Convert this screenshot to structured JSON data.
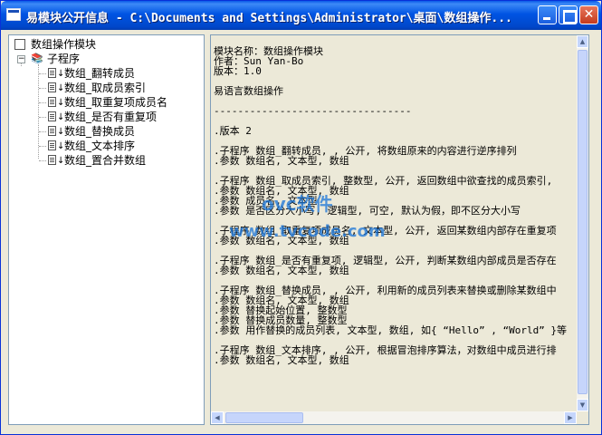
{
  "window": {
    "title": "易模块公开信息 - C:\\Documents and Settings\\Administrator\\桌面\\数组操作..."
  },
  "tree": {
    "root": {
      "label": "数组操作模块",
      "icon": "module-icon"
    },
    "group": {
      "label": "子程序",
      "icon": "books-icon",
      "expander": "−"
    },
    "items": [
      {
        "label": "数组_翻转成员",
        "icon": "subroutine-icon"
      },
      {
        "label": "数组_取成员索引",
        "icon": "subroutine-icon"
      },
      {
        "label": "数组_取重复项成员名",
        "icon": "subroutine-icon"
      },
      {
        "label": "数组_是否有重复项",
        "icon": "subroutine-icon"
      },
      {
        "label": "数组_替换成员",
        "icon": "subroutine-icon"
      },
      {
        "label": "数组_文本排序",
        "icon": "subroutine-icon"
      },
      {
        "label": "数组_置合并数组",
        "icon": "subroutine-icon"
      }
    ]
  },
  "content": {
    "text": "模块名称：数组操作模块\n作者：Sun Yan-Bo\n版本：1.0\n\n易语言数组操作\n\n---------------------------------\n\n.版本 2\n\n.子程序 数组_翻转成员, , 公开, 将数组原来的内容进行逆序排列\n.参数 数组名, 文本型, 数组\n\n.子程序 数组_取成员索引, 整数型, 公开, 返回数组中欲查找的成员索引,\n.参数 数组名, 文本型, 数组\n.参数 成员名, 文本型\n.参数 是否区分大小写, 逻辑型, 可空, 默认为假，即不区分大小写\n\n.子程序 数组_取重复项成员名, 文本型, 公开, 返回某数组内部存在重复项\n.参数 数组名, 文本型, 数组\n\n.子程序 数组_是否有重复项, 逻辑型, 公开, 判断某数组内部成员是否存在\n.参数 数组名, 文本型, 数组\n\n.子程序 数组_替换成员, , 公开, 利用新的成员列表来替换或删除某数组中\n.参数 数组名, 文本型, 数组\n.参数 替换起始位置, 整数型\n.参数 替换成员数量, 整数型\n.参数 用作替换的成员列表, 文本型, 数组, 如{ “Hello” , “World” }等\n\n.子程序 数组_文本排序, , 公开, 根据冒泡排序算法，对数组中成员进行排\n.参数 数组名, 文本型, 数组"
  },
  "watermark": {
    "line1": "ovc软件",
    "line2": "www.tvcode.com"
  },
  "colors": {
    "titlebar": "#0054e3",
    "window_bg": "#ece9d8",
    "border": "#7f9db9",
    "watermark": "#1874d8"
  }
}
